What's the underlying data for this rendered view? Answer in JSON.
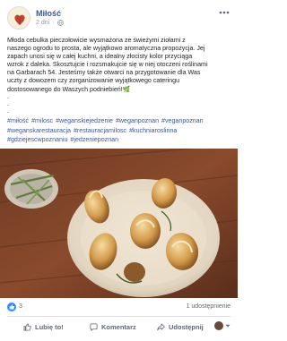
{
  "post": {
    "page_name": "Miłość",
    "time": "2 dni",
    "icons": {
      "avatar": "restaurant-logo",
      "privacy": "globe-icon",
      "more": "more-options-icon"
    },
    "body_lines": [
      "Młoda cebulka pieczołowicie wysmażona ze świeżymi ziołami z",
      "naszego ogrodu to prosta, ale wyjątkowo aromatyczna propozycja. Jej",
      "zapach unosi się w całej kuchni, a idealny złocisty kolor przyciąga",
      "wzrok z daleka. Skosztujcie i rozsmakujcie się w niej otoczeni roślinami",
      "na Garbarach 54. Jesteśmy także otwarci na przygotowanie dla Was",
      "uczty z dowozem czy zorganizowanie wyjątkowego cateringu",
      "dostosowanego do Waszych podniebień!"
    ],
    "emoji": "🌿",
    "dots": [
      ".",
      ".",
      "."
    ],
    "hashtags": [
      "#miłość",
      "#milosc",
      "#weganskiejedzenie",
      "#weganpoznan",
      "#veganpoznan",
      "#weganskarestauracja",
      "#restauracjamilosc",
      "#kuchniaroslinna",
      "#gdziejescwpoznaniu",
      "#jedzeniepoznan"
    ],
    "image": {
      "description_icon": "roasted-onions-photo"
    }
  },
  "stats": {
    "like_count": "3",
    "shares": "1 udostępnienie"
  },
  "actions": {
    "like_label": "Lubię to!",
    "comment_label": "Komentarz",
    "share_label": "Udostępnij"
  },
  "colors": {
    "link": "#385898",
    "secondary_text": "#606770",
    "like_blue": "#2d88ff"
  }
}
